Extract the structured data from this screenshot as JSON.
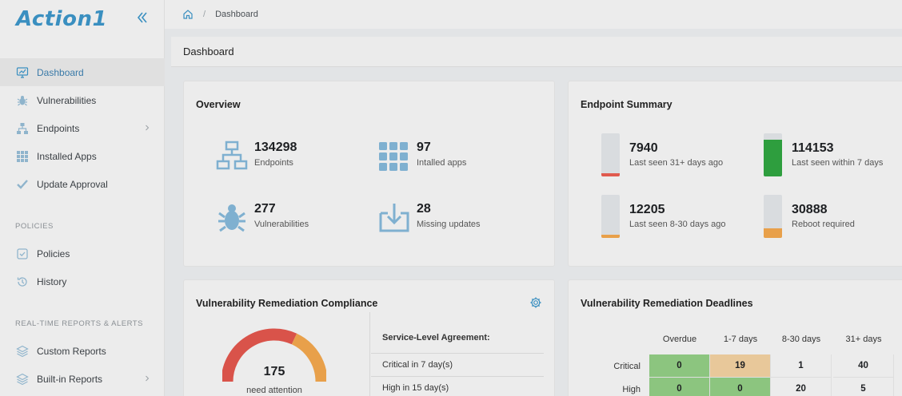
{
  "app": {
    "logo_text": "Action1"
  },
  "breadcrumb": {
    "home": "home-icon",
    "current": "Dashboard"
  },
  "sidebar": {
    "items": [
      {
        "label": "Dashboard",
        "icon": "monitor-chart-icon",
        "active": true
      },
      {
        "label": "Vulnerabilities",
        "icon": "bug-icon"
      },
      {
        "label": "Endpoints",
        "icon": "network-icon",
        "has_submenu": true
      },
      {
        "label": "Installed Apps",
        "icon": "grid-icon"
      },
      {
        "label": "Update Approval",
        "icon": "check-shield-icon"
      }
    ],
    "policies_label": "POLICIES",
    "policies": [
      {
        "label": "Policies",
        "icon": "checkbox-icon"
      },
      {
        "label": "History",
        "icon": "history-icon"
      }
    ],
    "reports_label": "REAL-TIME REPORTS & ALERTS",
    "reports": [
      {
        "label": "Custom Reports",
        "icon": "layers-icon"
      },
      {
        "label": "Built-in Reports",
        "icon": "layers-icon",
        "has_submenu": true
      }
    ]
  },
  "page": {
    "title": "Dashboard"
  },
  "overview": {
    "title": "Overview",
    "items": [
      {
        "value": "134298",
        "label": "Endpoints",
        "icon": "network-icon"
      },
      {
        "value": "97",
        "label": "Intalled apps",
        "icon": "grid-icon"
      },
      {
        "value": "277",
        "label": "Vulnerabilities",
        "icon": "bug-icon"
      },
      {
        "value": "28",
        "label": "Missing updates",
        "icon": "download-icon"
      }
    ]
  },
  "endpoint_summary": {
    "title": "Endpoint Summary",
    "items": [
      {
        "value": "7940",
        "label": "Last seen 31+ days ago",
        "fill": 0.07,
        "color": "#e05a4e"
      },
      {
        "value": "114153",
        "label": "Last seen within 7 days",
        "fill": 0.85,
        "color": "#2e9e3e"
      },
      {
        "value": "12205",
        "label": "Last seen 8-30 days ago",
        "fill": 0.08,
        "color": "#e8a04a"
      },
      {
        "value": "30888",
        "label": "Reboot required",
        "fill": 0.22,
        "color": "#e8a04a"
      }
    ]
  },
  "compliance": {
    "title": "Vulnerability Remediation Compliance",
    "gauge_value": "175",
    "gauge_label": "need attention",
    "sla_title": "Service-Level Agreement:",
    "sla_rows": [
      "Critical in 7 day(s)",
      "High in 15 day(s)"
    ],
    "colors": {
      "red": "#d9534a",
      "orange": "#e8a04a"
    }
  },
  "deadlines": {
    "title": "Vulnerability Remediation Deadlines",
    "columns": [
      "Overdue",
      "1-7 days",
      "8-30 days",
      "31+ days"
    ],
    "rows": [
      {
        "label": "Critical",
        "values": [
          "0",
          "19",
          "1",
          "40"
        ],
        "colors": [
          "#8cc57f",
          "#e8c89a",
          "#ececec",
          "#ececec"
        ]
      },
      {
        "label": "High",
        "values": [
          "0",
          "0",
          "20",
          "5"
        ],
        "colors": [
          "#8cc57f",
          "#8cc57f",
          "#ececec",
          "#ececec"
        ]
      }
    ]
  }
}
